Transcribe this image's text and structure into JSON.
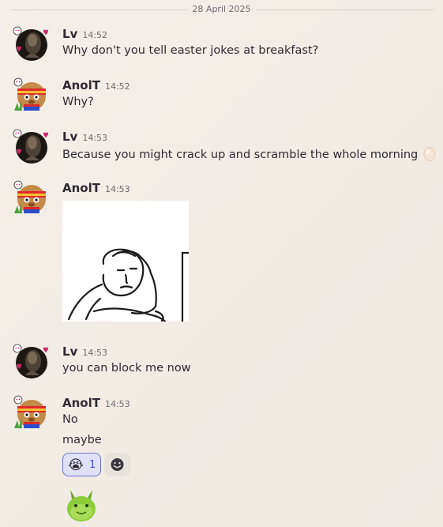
{
  "date_divider": "28 April 2025",
  "users": {
    "lv": {
      "name": "Lv"
    },
    "anol": {
      "name": "AnolT"
    }
  },
  "messages": [
    {
      "author": "Lv",
      "time": "14:52",
      "text": "Why don't you tell easter jokes at breakfast?"
    },
    {
      "author": "AnolT",
      "time": "14:52",
      "text": "Why?"
    },
    {
      "author": "Lv",
      "time": "14:53",
      "text": "Because you might crack up and scramble the whole morning",
      "emoji": "egg"
    },
    {
      "author": "AnolT",
      "time": "14:53",
      "attachment": "meme-thinking-man-image"
    },
    {
      "author": "Lv",
      "time": "14:53",
      "text": "you can block me now"
    },
    {
      "author": "AnolT",
      "time": "14:53",
      "text": "No",
      "followup": "maybe"
    }
  ],
  "reactions": [
    {
      "emoji": "😭",
      "count": "1"
    }
  ],
  "colors": {
    "background": "#f3ede7",
    "reaction_active_bg": "#e0e1f6",
    "reaction_active_border": "#6c73d6"
  },
  "icons": [
    "smile-add-reaction-icon",
    "heart-icon",
    "egg-icon"
  ]
}
